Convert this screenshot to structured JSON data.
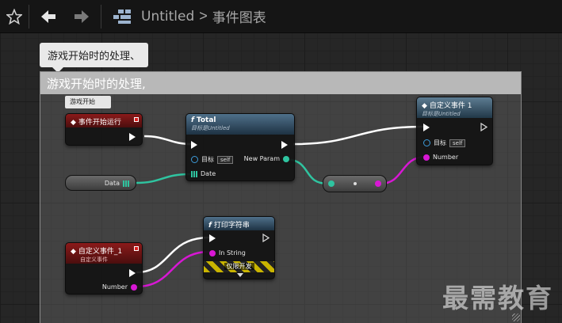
{
  "breadcrumb": {
    "blueprint": "Untitled",
    "graph": "事件图表"
  },
  "comment": {
    "bubble": "游戏开始时的处理、",
    "title": "游戏开始时的处理,"
  },
  "nodes": {
    "begin_play": {
      "bubble": "游戏开始",
      "title": "事件开始运行"
    },
    "data_var": {
      "label": "Data"
    },
    "total": {
      "title": "Total",
      "target": "目标是Untitled",
      "self_label": "目标",
      "self_chip": "self",
      "date_pin": "Date",
      "new_param": "New Param"
    },
    "custom_event_1": {
      "title": "自定义事件 1",
      "target": "目标是Untitled",
      "self_label": "目标",
      "self_chip": "self",
      "number_pin": "Number"
    },
    "custom_event_1b": {
      "title": "自定义事件_1",
      "subtitle": "自定义事件",
      "number_pin": "Number"
    },
    "print_string": {
      "title": "打印字符串",
      "in_string": "In String",
      "dev_only": "仅限开发"
    }
  },
  "watermark": "最需教育",
  "colors": {
    "exec_wire": "#ffffff",
    "struct_wire": "#2fc4a0",
    "int_wire": "#d817d4",
    "event_header": "#8b1a1a",
    "function_header": "#4f708a"
  }
}
